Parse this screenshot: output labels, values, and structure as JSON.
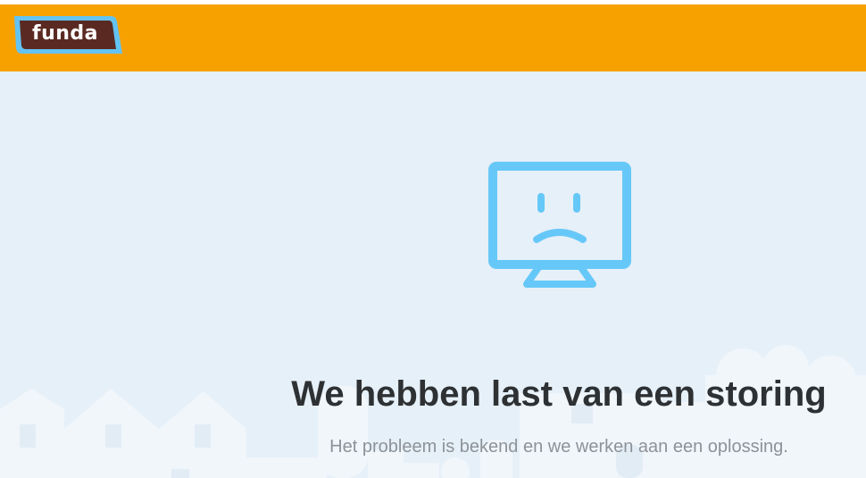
{
  "header": {
    "logo_text": "funda",
    "background_color": "#f7a100"
  },
  "error": {
    "icon": "sad-monitor-icon",
    "title": "We hebben last van een storing",
    "subtitle": "Het probleem is bekend en we werken aan een oplossing."
  },
  "colors": {
    "page_background": "#e6f0f8",
    "icon_color": "#66c8f8",
    "logo_brown": "#5a2a22",
    "logo_blue": "#63c3f2",
    "title_color": "#2e3133",
    "subtitle_color": "#8d9298"
  }
}
